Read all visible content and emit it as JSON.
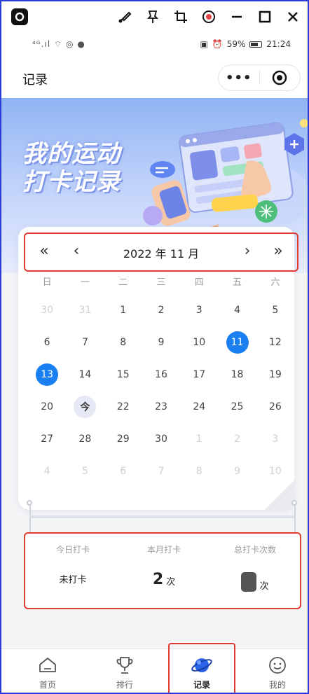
{
  "colors": {
    "accent": "#1a7ff0",
    "highlight_box": "#e23a2e",
    "frame": "#2c3cd8"
  },
  "window_toolbar": {
    "icons": [
      "app-logo-icon",
      "brush-icon",
      "pin-icon",
      "crop-icon",
      "record-icon",
      "minimize-icon",
      "maximize-icon",
      "close-icon"
    ]
  },
  "statusbar": {
    "left_icons": "⁴ᴳ.ıl ⌔ ◎ ●",
    "battery": "59%",
    "time": "21:24"
  },
  "navbar": {
    "title": "记录",
    "more": "•••"
  },
  "banner": {
    "line1": "我的运动",
    "line2": "打卡记录"
  },
  "calendar": {
    "month_label": "2022 年 11 月",
    "prev_year": "«",
    "prev_month": "‹",
    "next_month": "›",
    "next_year": "»",
    "weekdays": [
      "日",
      "一",
      "二",
      "三",
      "四",
      "五",
      "六"
    ],
    "weeks": [
      [
        {
          "d": "30",
          "s": "muted"
        },
        {
          "d": "31",
          "s": "muted"
        },
        {
          "d": "1",
          "s": ""
        },
        {
          "d": "2",
          "s": ""
        },
        {
          "d": "3",
          "s": ""
        },
        {
          "d": "4",
          "s": ""
        },
        {
          "d": "5",
          "s": ""
        }
      ],
      [
        {
          "d": "6",
          "s": ""
        },
        {
          "d": "7",
          "s": ""
        },
        {
          "d": "8",
          "s": ""
        },
        {
          "d": "9",
          "s": ""
        },
        {
          "d": "10",
          "s": ""
        },
        {
          "d": "11",
          "s": "checked"
        },
        {
          "d": "12",
          "s": ""
        }
      ],
      [
        {
          "d": "13",
          "s": "checked"
        },
        {
          "d": "14",
          "s": ""
        },
        {
          "d": "15",
          "s": ""
        },
        {
          "d": "16",
          "s": ""
        },
        {
          "d": "17",
          "s": ""
        },
        {
          "d": "18",
          "s": ""
        },
        {
          "d": "19",
          "s": ""
        }
      ],
      [
        {
          "d": "20",
          "s": ""
        },
        {
          "d": "今",
          "s": "today"
        },
        {
          "d": "22",
          "s": ""
        },
        {
          "d": "23",
          "s": ""
        },
        {
          "d": "24",
          "s": ""
        },
        {
          "d": "25",
          "s": ""
        },
        {
          "d": "26",
          "s": ""
        }
      ],
      [
        {
          "d": "27",
          "s": ""
        },
        {
          "d": "28",
          "s": ""
        },
        {
          "d": "29",
          "s": ""
        },
        {
          "d": "30",
          "s": ""
        },
        {
          "d": "1",
          "s": "muted"
        },
        {
          "d": "2",
          "s": "muted"
        },
        {
          "d": "3",
          "s": "muted"
        }
      ],
      [
        {
          "d": "4",
          "s": "muted"
        },
        {
          "d": "5",
          "s": "muted"
        },
        {
          "d": "6",
          "s": "muted"
        },
        {
          "d": "7",
          "s": "muted"
        },
        {
          "d": "8",
          "s": "muted"
        },
        {
          "d": "9",
          "s": "muted"
        },
        {
          "d": "10",
          "s": "muted"
        }
      ]
    ]
  },
  "stats": {
    "today_label": "今日打卡",
    "today_value": "未打卡",
    "month_label": "本月打卡",
    "month_value": "2",
    "month_unit": "次",
    "total_label": "总打卡次数",
    "total_unit": "次"
  },
  "tabs": [
    {
      "label": "首页",
      "icon": "home-icon",
      "active": false
    },
    {
      "label": "排行",
      "icon": "trophy-icon",
      "active": false
    },
    {
      "label": "记录",
      "icon": "planet-icon",
      "active": true
    },
    {
      "label": "我的",
      "icon": "smile-icon",
      "active": false
    }
  ]
}
